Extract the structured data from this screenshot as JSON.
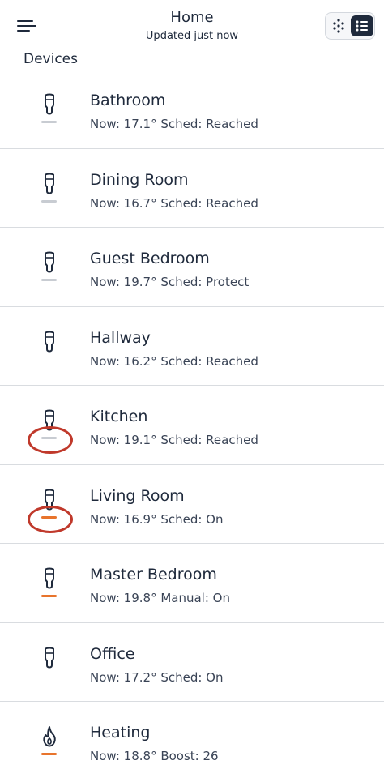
{
  "header": {
    "title": "Home",
    "subtitle": "Updated just now",
    "menu_icon": "hamburger-menu-icon",
    "grid_view_icon": "grid-dots-icon",
    "list_view_icon": "list-icon"
  },
  "section_label": "Devices",
  "colors": {
    "status_idle": "#c8ccd2",
    "status_active": "#e8742c",
    "annotation": "#c0392b",
    "text_primary": "#1f2a3c"
  },
  "devices": [
    {
      "name": "Bathroom",
      "status": "Now: 17.1° Sched: Reached",
      "icon": "thermostat-icon",
      "bar": "idle",
      "annotated": false
    },
    {
      "name": "Dining Room",
      "status": "Now: 16.7° Sched: Reached",
      "icon": "thermostat-icon",
      "bar": "idle",
      "annotated": false
    },
    {
      "name": "Guest Bedroom",
      "status": "Now: 19.7° Sched: Protect",
      "icon": "thermostat-icon",
      "bar": "idle",
      "annotated": false
    },
    {
      "name": "Hallway",
      "status": "Now: 16.2° Sched: Reached",
      "icon": "thermostat-icon",
      "bar": "none",
      "annotated": false
    },
    {
      "name": "Kitchen",
      "status": "Now: 19.1° Sched: Reached",
      "icon": "thermostat-icon",
      "bar": "idle",
      "annotated": true
    },
    {
      "name": "Living Room",
      "status": "Now: 16.9° Sched: On",
      "icon": "thermostat-icon",
      "bar": "active",
      "annotated": true
    },
    {
      "name": "Master Bedroom",
      "status": "Now: 19.8° Manual: On",
      "icon": "thermostat-icon",
      "bar": "active",
      "annotated": false
    },
    {
      "name": "Office",
      "status": "Now: 17.2° Sched: On",
      "icon": "thermostat-icon",
      "bar": "none",
      "annotated": false
    },
    {
      "name": "Heating",
      "status": "Now: 18.8° Boost: 26",
      "icon": "flame-icon",
      "bar": "active",
      "annotated": false
    }
  ]
}
